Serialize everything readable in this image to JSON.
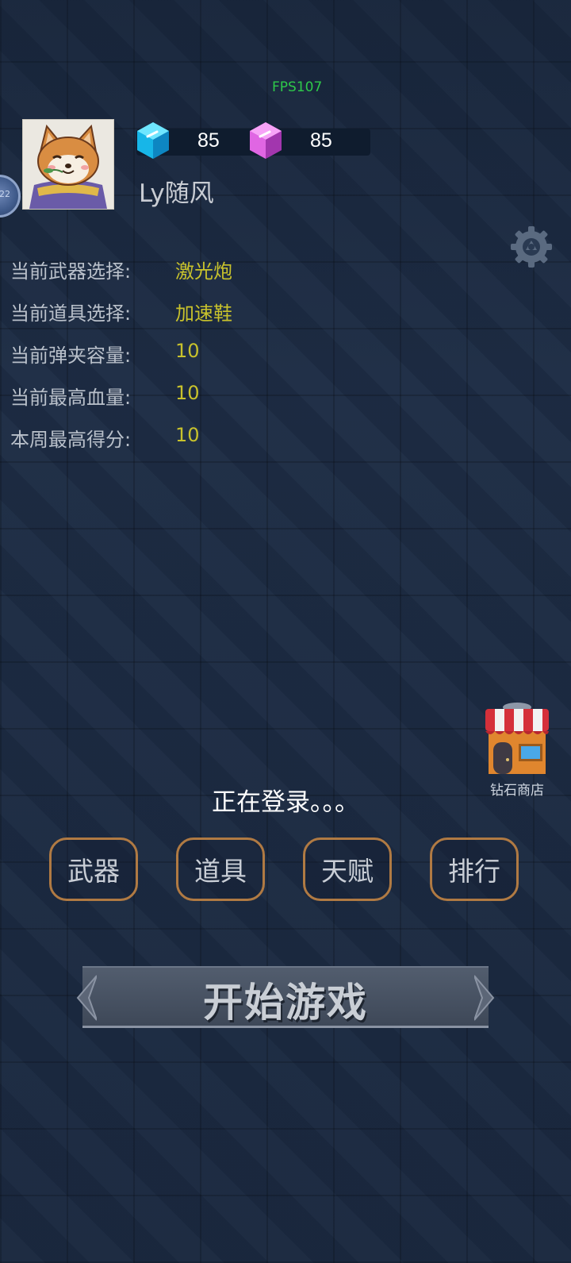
{
  "hud": {
    "fps": "FPS107"
  },
  "player": {
    "name": "Ly随风",
    "avatar": "shiba-dog-avatar",
    "level_badge": "22"
  },
  "currency": {
    "blue_gem": {
      "count": "85",
      "icon": "blue-gem-icon",
      "color": "#27c6f0"
    },
    "pink_gem": {
      "count": "85",
      "icon": "pink-gem-icon",
      "color": "#e05ce0"
    }
  },
  "stats": [
    {
      "label": "当前武器选择:",
      "value": "激光炮"
    },
    {
      "label": "当前道具选择:",
      "value": "加速鞋"
    },
    {
      "label": "当前弹夹容量:",
      "value": "10"
    },
    {
      "label": "当前最高血量:",
      "value": "10"
    },
    {
      "label": "本周最高得分:",
      "value": "10"
    }
  ],
  "shop": {
    "label": "钻石商店",
    "icon": "shop-icon"
  },
  "status": {
    "login": "正在登录。。。"
  },
  "menu": {
    "weapons": "武器",
    "items": "道具",
    "talent": "天赋",
    "rank": "排行"
  },
  "start_button": {
    "label": "开始游戏"
  },
  "colors": {
    "value_text": "#c8c22c",
    "fps_text": "#2ec94a",
    "button_border": "#b07a43",
    "background": "#1d2c44"
  }
}
